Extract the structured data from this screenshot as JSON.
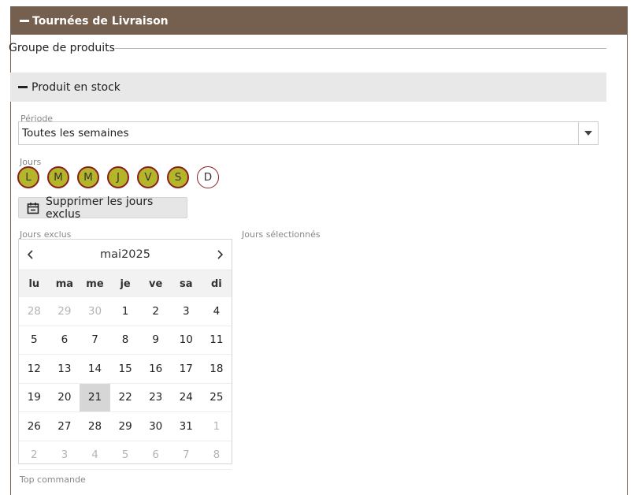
{
  "panel": {
    "title": "Tournées de Livraison"
  },
  "group": {
    "title": "Groupe de produits"
  },
  "section": {
    "title": "Produit en stock"
  },
  "periode": {
    "label": "Période",
    "value": "Toutes les semaines"
  },
  "jours": {
    "label": "Jours",
    "days": [
      {
        "letter": "L",
        "active": true
      },
      {
        "letter": "M",
        "active": true
      },
      {
        "letter": "M",
        "active": true
      },
      {
        "letter": "J",
        "active": true
      },
      {
        "letter": "V",
        "active": true
      },
      {
        "letter": "S",
        "active": true
      },
      {
        "letter": "D",
        "active": false
      }
    ]
  },
  "clear_button": {
    "label": "Supprimer les jours exclus",
    "icon": "calendar-icon"
  },
  "jours_exclus": {
    "label": "Jours exclus"
  },
  "jours_selectionnes": {
    "label": "Jours sélectionnés"
  },
  "calendar": {
    "month": "mai",
    "year": "2025",
    "weekdays": [
      "lu",
      "ma",
      "me",
      "je",
      "ve",
      "sa",
      "di"
    ],
    "weeks": [
      [
        {
          "d": "28",
          "o": true
        },
        {
          "d": "29",
          "o": true
        },
        {
          "d": "30",
          "o": true
        },
        {
          "d": "1"
        },
        {
          "d": "2"
        },
        {
          "d": "3"
        },
        {
          "d": "4"
        }
      ],
      [
        {
          "d": "5"
        },
        {
          "d": "6"
        },
        {
          "d": "7"
        },
        {
          "d": "8"
        },
        {
          "d": "9"
        },
        {
          "d": "10"
        },
        {
          "d": "11"
        }
      ],
      [
        {
          "d": "12"
        },
        {
          "d": "13"
        },
        {
          "d": "14"
        },
        {
          "d": "15"
        },
        {
          "d": "16"
        },
        {
          "d": "17"
        },
        {
          "d": "18"
        }
      ],
      [
        {
          "d": "19"
        },
        {
          "d": "20"
        },
        {
          "d": "21",
          "today": true
        },
        {
          "d": "22"
        },
        {
          "d": "23"
        },
        {
          "d": "24"
        },
        {
          "d": "25"
        }
      ],
      [
        {
          "d": "26"
        },
        {
          "d": "27"
        },
        {
          "d": "28"
        },
        {
          "d": "29"
        },
        {
          "d": "30"
        },
        {
          "d": "31"
        },
        {
          "d": "1",
          "o": true
        }
      ],
      [
        {
          "d": "2",
          "o": true
        },
        {
          "d": "3",
          "o": true
        },
        {
          "d": "4",
          "o": true
        },
        {
          "d": "5",
          "o": true
        },
        {
          "d": "6",
          "o": true
        },
        {
          "d": "7",
          "o": true
        },
        {
          "d": "8",
          "o": true
        }
      ]
    ]
  },
  "top_commande": {
    "label": "Top commande"
  },
  "colors": {
    "header_bg": "#75604f",
    "day_active": "#b5b52a",
    "day_border": "#8b1f1f",
    "today_bg": "#d6d6d6"
  }
}
